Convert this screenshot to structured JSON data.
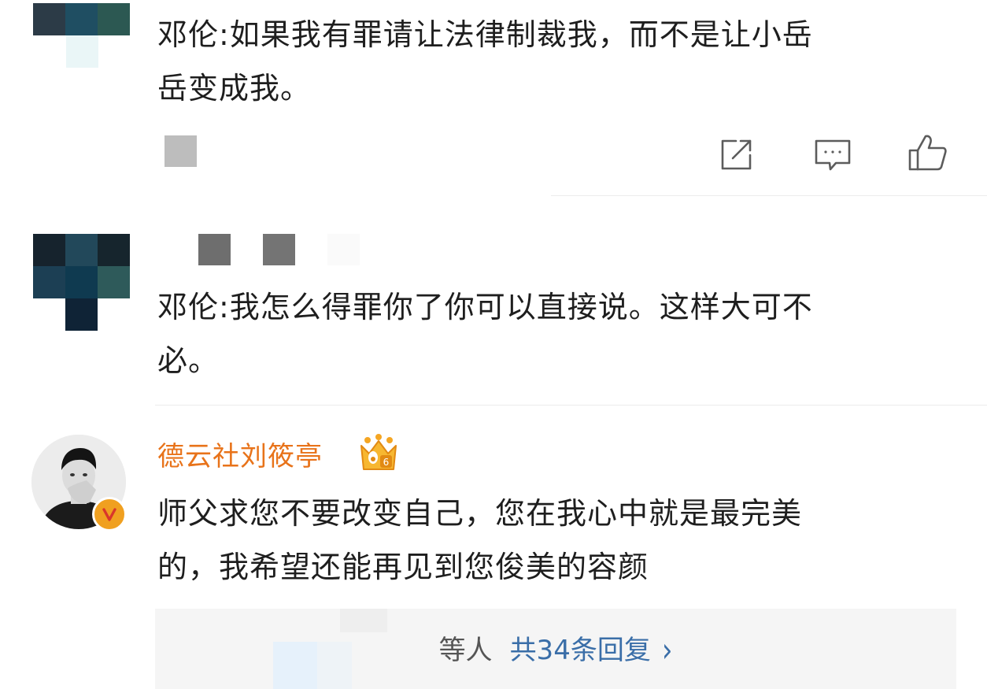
{
  "comments": [
    {
      "text_line1": "邓伦:如果我有罪请让法律制裁我，而不是让小岳",
      "text_line2": "岳变成我。",
      "actions": [
        "share-icon",
        "comment-icon",
        "like-icon"
      ]
    },
    {
      "text_line1": "邓伦:我怎么得罪你了你可以直接说。这样大可不",
      "text_line2": "必。"
    },
    {
      "username": "德云社刘筱亭",
      "verified_badge": "V",
      "level_badge": "6",
      "text_line1": "师父求您不要改变自己，您在我心中就是最完美",
      "text_line2": "的，我希望还能再见到您俊美的容颜",
      "replies": {
        "prefix": "等人",
        "total_label": "共34条回复",
        "chevron": "›"
      }
    }
  ],
  "colors": {
    "username": "#e8731a",
    "link": "#3a6ea8",
    "verified": "#f0a020"
  }
}
